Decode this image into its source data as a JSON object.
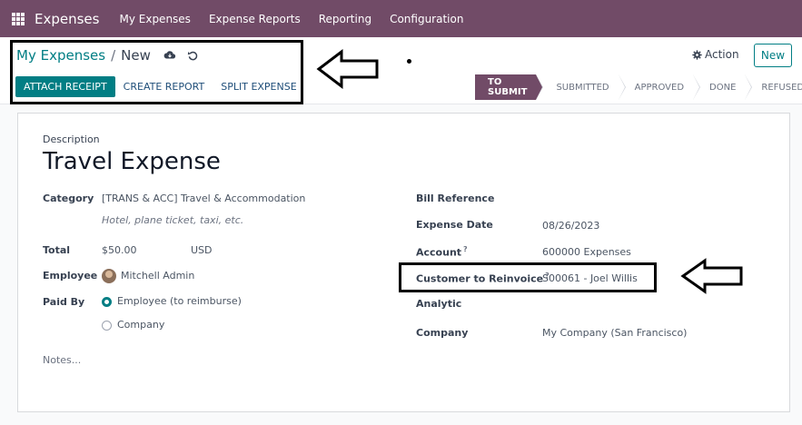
{
  "navbar": {
    "app_name": "Expenses",
    "menu": [
      "My Expenses",
      "Expense Reports",
      "Reporting",
      "Configuration"
    ]
  },
  "control": {
    "breadcrumb_parent": "My Expenses",
    "breadcrumb_sep": "/",
    "breadcrumb_current": "New",
    "buttons": {
      "attach_receipt": "ATTACH RECEIPT",
      "create_report": "CREATE REPORT",
      "split_expense": "SPLIT EXPENSE"
    },
    "action_label": "Action",
    "new_label": "New"
  },
  "status": {
    "stages": [
      "TO SUBMIT",
      "SUBMITTED",
      "APPROVED",
      "DONE",
      "REFUSED"
    ],
    "active": "TO SUBMIT"
  },
  "form": {
    "description_label": "Description",
    "description_value": "Travel Expense",
    "category_label": "Category",
    "category_value": "[TRANS & ACC] Travel & Accommodation",
    "category_hint": "Hotel, plane ticket, taxi, etc.",
    "total_label": "Total",
    "total_value": "$50.00",
    "currency": "USD",
    "employee_label": "Employee",
    "employee_value": "Mitchell Admin",
    "paid_by_label": "Paid By",
    "paid_by_options": [
      "Employee (to reimburse)",
      "Company"
    ],
    "paid_by_selected": "Employee (to reimburse)",
    "notes_placeholder": "Notes...",
    "bill_reference_label": "Bill Reference",
    "expense_date_label": "Expense Date",
    "expense_date_value": "08/26/2023",
    "account_label": "Account",
    "account_value": "600000 Expenses",
    "customer_label": "Customer to Reinvoice",
    "customer_value": "S00061 - Joel Willis",
    "analytic_label": "Analytic",
    "company_label": "Company",
    "company_value": "My Company (San Francisco)",
    "help_mark": "?"
  },
  "colors": {
    "brand": "#714b67",
    "accent": "#017e84",
    "annotation": "#000000"
  }
}
